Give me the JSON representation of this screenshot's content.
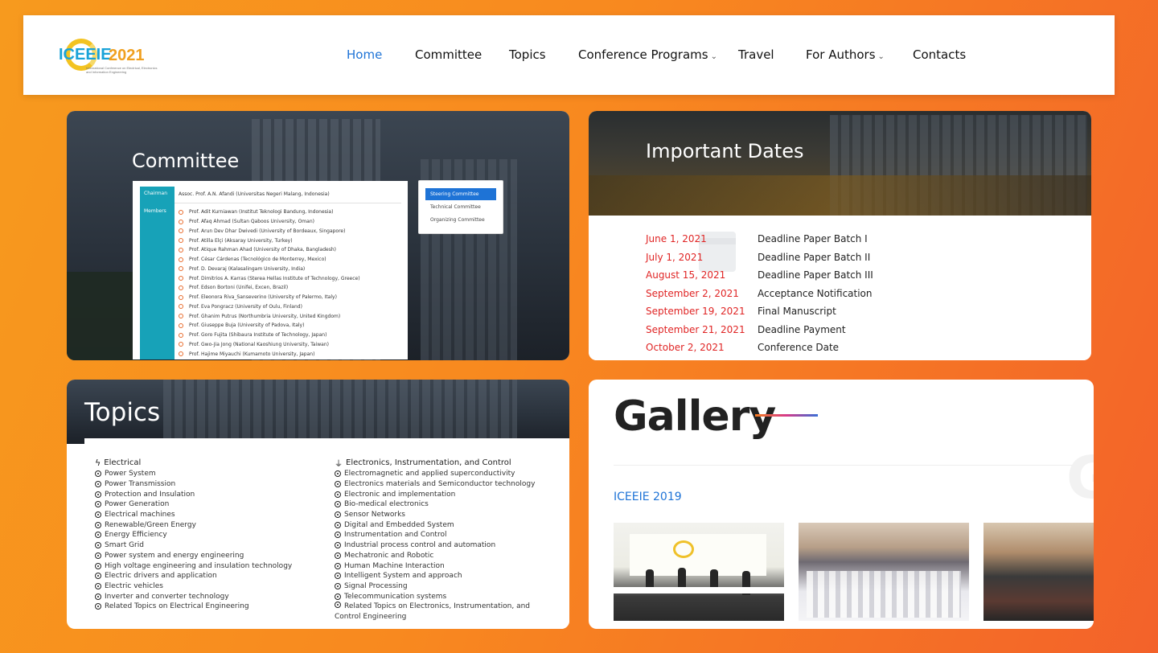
{
  "nav": {
    "logo": {
      "mark": "ICEEIE",
      "year": "2021",
      "subtitle": "International Conference on Electrical, Electronics and Information Engineering"
    },
    "items": [
      {
        "label": "Home",
        "active": true,
        "dropdown": false
      },
      {
        "label": "Committee",
        "active": false,
        "dropdown": false
      },
      {
        "label": "Topics",
        "active": false,
        "dropdown": false
      },
      {
        "label": "Conference Programs",
        "active": false,
        "dropdown": true
      },
      {
        "label": "Travel",
        "active": false,
        "dropdown": false
      },
      {
        "label": "For Authors",
        "active": false,
        "dropdown": true
      },
      {
        "label": "Contacts",
        "active": false,
        "dropdown": false
      }
    ],
    "caret": "⌄"
  },
  "committee": {
    "title": "Committee",
    "chairman_label": "Chairman",
    "chairman": "Assoc. Prof. A.N. Afandi (Universitas Negeri Malang, Indonesia)",
    "members_label": "Members",
    "members": [
      "Prof. Adit Kurniawan (Institut Teknologi Bandung, Indonesia)",
      "Prof. Afaq Ahmad (Sultan Qaboos University, Oman)",
      "Prof. Arun Dev Dhar Dwivedi (University of Bordeaux, Singapore)",
      "Prof. Atilla Elçi (Aksaray University, Turkey)",
      "Prof. Atique Rahman Ahad (University of Dhaka, Bangladesh)",
      "Prof. César Cárdenas (Tecnológico de Monterrey, Mexico)",
      "Prof. D. Devaraj (Kalasalingam University, India)",
      "Prof. Dimitrios A. Karras (Sterea Hellas Institute of Technology, Greece)",
      "Prof. Edson Bortoni (Unifei, Excen, Brazil)",
      "Prof. Eleonora Riva_Sanseverino (University of Palermo, Italy)",
      "Prof. Eva Pongracz (University of Oulu, Finland)",
      "Prof. Ghanim Putrus (Northumbria University, United Kingdom)",
      "Prof. Giuseppe Buja (University of Padova, Italy)",
      "Prof. Goro Fujita (Shibaura Institute of Technology, Japan)",
      "Prof. Gwo-Jia Jong (National Kaoshiung University, Taiwan)",
      "Prof. Hajime Miyauchi (Kumamoto University, Japan)"
    ],
    "tabs": [
      "Steering Committee",
      "Technical Committee",
      "Organizing Committee"
    ]
  },
  "dates": {
    "title": "Important Dates",
    "rows": [
      {
        "date": "June 1, 2021",
        "label": "Deadline Paper Batch I"
      },
      {
        "date": "July 1, 2021",
        "label": "Deadline Paper Batch II"
      },
      {
        "date": "August 15, 2021",
        "label": "Deadline Paper Batch III"
      },
      {
        "date": "September 2, 2021",
        "label": "Acceptance Notification"
      },
      {
        "date": "September 19, 2021",
        "label": "Final Manuscript"
      },
      {
        "date": "September 21, 2021",
        "label": "Deadline Payment"
      },
      {
        "date": "October 2, 2021",
        "label": "Conference Date"
      }
    ]
  },
  "topics": {
    "title": "Topics",
    "left": {
      "heading": "Electrical",
      "icon": "bolt-icon",
      "items": [
        "Power System",
        "Power Transmission",
        "Protection and Insulation",
        "Power Generation",
        "Electrical machines",
        "Renewable/Green Energy",
        "Energy Efficiency",
        "Smart Grid",
        "Power system and energy engineering",
        "High voltage engineering and insulation technology",
        "Electric drivers and application",
        "Electric vehicles",
        "Inverter and converter technology",
        "Related Topics on Electrical Engineering"
      ]
    },
    "right": {
      "heading": "Electronics, Instrumentation, and Control",
      "icon": "plug-icon",
      "items": [
        "Electromagnetic and applied superconductivity",
        "Electronics materials and Semiconductor technology",
        "Electronic and implementation",
        "Bio-medical electronics",
        "Sensor Networks",
        "Digital and Embedded System",
        "Instrumentation and Control",
        "Industrial process control and automation",
        "Mechatronic and Robotic",
        "Human Machine Interaction",
        "Intelligent System and approach",
        "Signal Processing",
        "Telecommunication systems",
        "Related Topics on Electronics, Instrumentation, and Control Engineering"
      ]
    }
  },
  "gallery": {
    "title": "Gallery",
    "year_label": "ICEEIE 2019",
    "ghost": "G"
  },
  "colors": {
    "accent": "#1e73d6",
    "date_red": "#e02424",
    "committee_teal": "#17a2b8",
    "bullet_orange": "#e86b2c"
  }
}
